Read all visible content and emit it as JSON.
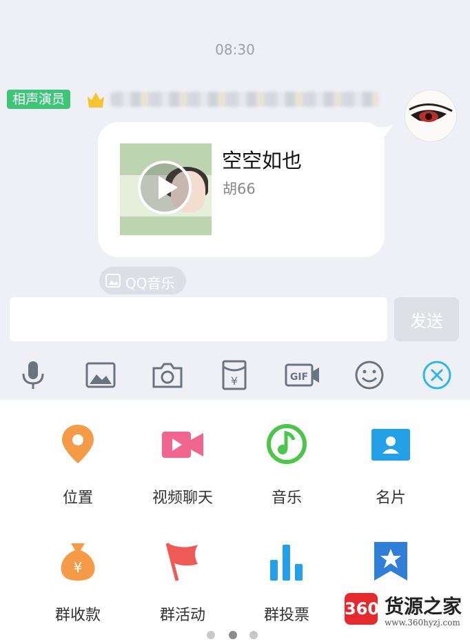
{
  "chat": {
    "timestamp": "08:30",
    "sender": {
      "rank_badge": "相声演员",
      "rank_badge_color": "#3fc57a"
    },
    "message": {
      "song_title": "空空如也",
      "artist": "胡66",
      "source_label": "QQ音乐",
      "cover_icon": "album-cover-image",
      "play_icon": "play-icon"
    }
  },
  "input_bar": {
    "send_label": "发送"
  },
  "toolbar": {
    "items": [
      {
        "icon": "microphone-icon"
      },
      {
        "icon": "image-icon"
      },
      {
        "icon": "camera-icon"
      },
      {
        "icon": "red-packet-icon"
      },
      {
        "icon": "gif-icon"
      },
      {
        "icon": "emoji-icon"
      },
      {
        "icon": "close-circle-icon",
        "color": "#2db6e6"
      }
    ]
  },
  "features": {
    "items": [
      {
        "label": "位置",
        "icon": "location-pin-icon",
        "color": "#f59a47"
      },
      {
        "label": "视频聊天",
        "icon": "video-camera-icon",
        "color": "#f0668e"
      },
      {
        "label": "音乐",
        "icon": "music-note-icon",
        "color": "#4cc64a"
      },
      {
        "label": "名片",
        "icon": "contact-card-icon",
        "color": "#23a0e8"
      },
      {
        "label": "群收款",
        "icon": "money-bag-icon",
        "color": "#f59a47"
      },
      {
        "label": "群活动",
        "icon": "flag-icon",
        "color": "#ef5a57"
      },
      {
        "label": "群投票",
        "icon": "bar-chart-icon",
        "color": "#23a0e8"
      },
      {
        "label": "",
        "icon": "bookmark-star-icon",
        "color": "#2f7fd8"
      }
    ]
  },
  "pagination": {
    "pages": 3,
    "current": 2
  },
  "watermark": {
    "logo_text": "360",
    "name": "货源之家",
    "url": "www.360hyzj.com"
  }
}
